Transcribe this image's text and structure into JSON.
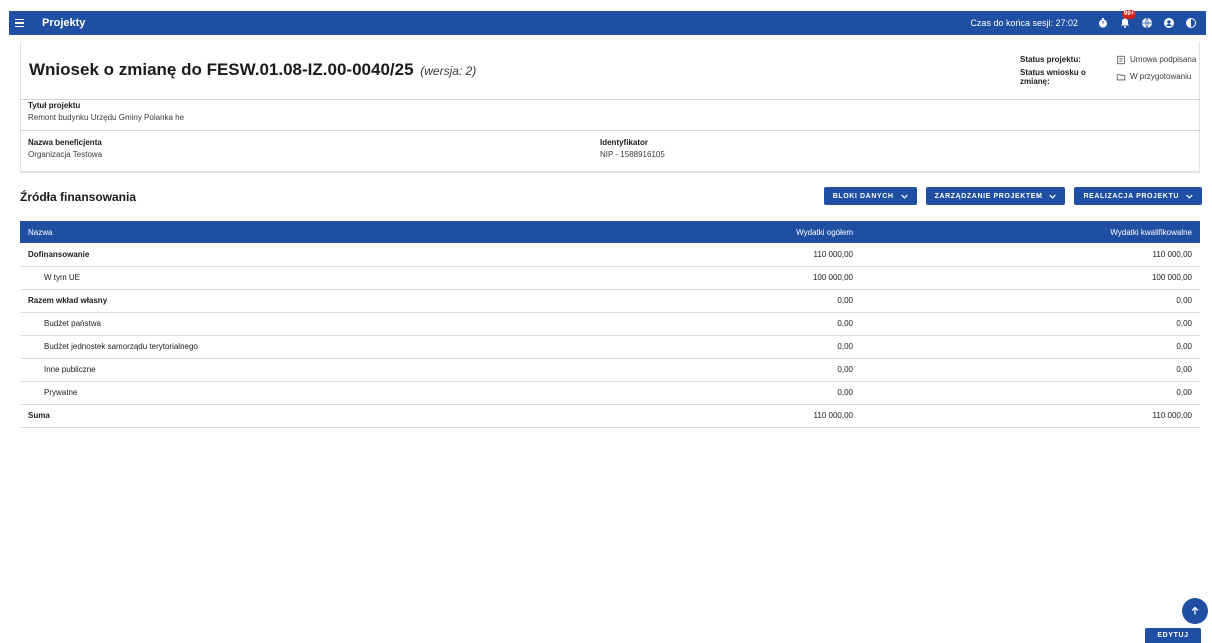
{
  "topbar": {
    "title": "Projekty",
    "session_label": "Czas do końca sesji: 27:02",
    "notifications_badge": "99+",
    "icons": [
      "menu-icon",
      "timer-icon",
      "bell-icon",
      "globe-icon",
      "account-icon",
      "contrast-icon"
    ]
  },
  "header": {
    "title": "Wniosek o zmianę do FESW.01.08-IZ.00-0040/25",
    "version": "(wersja: 2)",
    "project_status_label": "Status projektu:",
    "project_status_value": "Umowa podpisana",
    "request_status_label": "Status wniosku o zmianę:",
    "request_status_value": "W przygotowaniu",
    "project_title_label": "Tytuł projektu",
    "project_title_value": "Remont budynku Urzędu Gminy Polanka he",
    "beneficiary_label": "Nazwa beneficjenta",
    "beneficiary_value": "Organizacja Testowa",
    "identifier_label": "Identyfikator",
    "identifier_value": "NIP - 1588916105"
  },
  "section": {
    "title": "Źródła finansowania"
  },
  "actions": {
    "data_blocks": "BLOKI DANYCH",
    "project_management": "ZARZĄDZANIE PROJEKTEM",
    "project_realization": "REALIZACJA PROJEKTU"
  },
  "table": {
    "headers": {
      "name": "Nazwa",
      "total": "Wydatki ogółem",
      "eligible": "Wydatki kwalifikowalne"
    },
    "rows": [
      {
        "name": "Dofinansowanie",
        "total": "110 000,00",
        "eligible": "110 000,00",
        "bold": true,
        "indent": false
      },
      {
        "name": "W tym UE",
        "total": "100 000,00",
        "eligible": "100 000,00",
        "bold": false,
        "indent": true
      },
      {
        "name": "Razem wkład własny",
        "total": "0,00",
        "eligible": "0,00",
        "bold": true,
        "indent": false
      },
      {
        "name": "Budżet państwa",
        "total": "0,00",
        "eligible": "0,00",
        "bold": false,
        "indent": true
      },
      {
        "name": "Budżet jednostek samorządu terytorialnego",
        "total": "0,00",
        "eligible": "0,00",
        "bold": false,
        "indent": true
      },
      {
        "name": "Inne publiczne",
        "total": "0,00",
        "eligible": "0,00",
        "bold": false,
        "indent": true
      },
      {
        "name": "Prywatne",
        "total": "0,00",
        "eligible": "0,00",
        "bold": false,
        "indent": true
      },
      {
        "name": "Suma",
        "total": "110 000,00",
        "eligible": "110 000,00",
        "bold": true,
        "indent": false
      }
    ]
  },
  "footer": {
    "edit_label": "EDYTUJ"
  },
  "colors": {
    "primary": "#1f4fa3",
    "badge": "#d5231c"
  }
}
